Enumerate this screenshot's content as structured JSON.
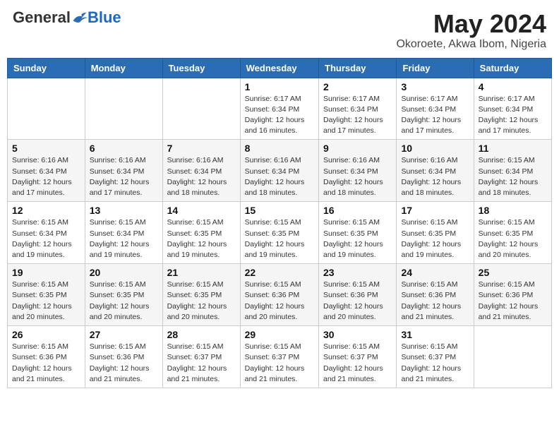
{
  "logo": {
    "general": "General",
    "blue": "Blue"
  },
  "title": {
    "month_year": "May 2024",
    "location": "Okoroete, Akwa Ibom, Nigeria"
  },
  "weekdays": [
    "Sunday",
    "Monday",
    "Tuesday",
    "Wednesday",
    "Thursday",
    "Friday",
    "Saturday"
  ],
  "weeks": [
    [
      {
        "day": "",
        "sunrise": "",
        "sunset": "",
        "daylight": ""
      },
      {
        "day": "",
        "sunrise": "",
        "sunset": "",
        "daylight": ""
      },
      {
        "day": "",
        "sunrise": "",
        "sunset": "",
        "daylight": ""
      },
      {
        "day": "1",
        "sunrise": "Sunrise: 6:17 AM",
        "sunset": "Sunset: 6:34 PM",
        "daylight": "Daylight: 12 hours and 16 minutes."
      },
      {
        "day": "2",
        "sunrise": "Sunrise: 6:17 AM",
        "sunset": "Sunset: 6:34 PM",
        "daylight": "Daylight: 12 hours and 17 minutes."
      },
      {
        "day": "3",
        "sunrise": "Sunrise: 6:17 AM",
        "sunset": "Sunset: 6:34 PM",
        "daylight": "Daylight: 12 hours and 17 minutes."
      },
      {
        "day": "4",
        "sunrise": "Sunrise: 6:17 AM",
        "sunset": "Sunset: 6:34 PM",
        "daylight": "Daylight: 12 hours and 17 minutes."
      }
    ],
    [
      {
        "day": "5",
        "sunrise": "Sunrise: 6:16 AM",
        "sunset": "Sunset: 6:34 PM",
        "daylight": "Daylight: 12 hours and 17 minutes."
      },
      {
        "day": "6",
        "sunrise": "Sunrise: 6:16 AM",
        "sunset": "Sunset: 6:34 PM",
        "daylight": "Daylight: 12 hours and 17 minutes."
      },
      {
        "day": "7",
        "sunrise": "Sunrise: 6:16 AM",
        "sunset": "Sunset: 6:34 PM",
        "daylight": "Daylight: 12 hours and 18 minutes."
      },
      {
        "day": "8",
        "sunrise": "Sunrise: 6:16 AM",
        "sunset": "Sunset: 6:34 PM",
        "daylight": "Daylight: 12 hours and 18 minutes."
      },
      {
        "day": "9",
        "sunrise": "Sunrise: 6:16 AM",
        "sunset": "Sunset: 6:34 PM",
        "daylight": "Daylight: 12 hours and 18 minutes."
      },
      {
        "day": "10",
        "sunrise": "Sunrise: 6:16 AM",
        "sunset": "Sunset: 6:34 PM",
        "daylight": "Daylight: 12 hours and 18 minutes."
      },
      {
        "day": "11",
        "sunrise": "Sunrise: 6:15 AM",
        "sunset": "Sunset: 6:34 PM",
        "daylight": "Daylight: 12 hours and 18 minutes."
      }
    ],
    [
      {
        "day": "12",
        "sunrise": "Sunrise: 6:15 AM",
        "sunset": "Sunset: 6:34 PM",
        "daylight": "Daylight: 12 hours and 19 minutes."
      },
      {
        "day": "13",
        "sunrise": "Sunrise: 6:15 AM",
        "sunset": "Sunset: 6:34 PM",
        "daylight": "Daylight: 12 hours and 19 minutes."
      },
      {
        "day": "14",
        "sunrise": "Sunrise: 6:15 AM",
        "sunset": "Sunset: 6:35 PM",
        "daylight": "Daylight: 12 hours and 19 minutes."
      },
      {
        "day": "15",
        "sunrise": "Sunrise: 6:15 AM",
        "sunset": "Sunset: 6:35 PM",
        "daylight": "Daylight: 12 hours and 19 minutes."
      },
      {
        "day": "16",
        "sunrise": "Sunrise: 6:15 AM",
        "sunset": "Sunset: 6:35 PM",
        "daylight": "Daylight: 12 hours and 19 minutes."
      },
      {
        "day": "17",
        "sunrise": "Sunrise: 6:15 AM",
        "sunset": "Sunset: 6:35 PM",
        "daylight": "Daylight: 12 hours and 19 minutes."
      },
      {
        "day": "18",
        "sunrise": "Sunrise: 6:15 AM",
        "sunset": "Sunset: 6:35 PM",
        "daylight": "Daylight: 12 hours and 20 minutes."
      }
    ],
    [
      {
        "day": "19",
        "sunrise": "Sunrise: 6:15 AM",
        "sunset": "Sunset: 6:35 PM",
        "daylight": "Daylight: 12 hours and 20 minutes."
      },
      {
        "day": "20",
        "sunrise": "Sunrise: 6:15 AM",
        "sunset": "Sunset: 6:35 PM",
        "daylight": "Daylight: 12 hours and 20 minutes."
      },
      {
        "day": "21",
        "sunrise": "Sunrise: 6:15 AM",
        "sunset": "Sunset: 6:35 PM",
        "daylight": "Daylight: 12 hours and 20 minutes."
      },
      {
        "day": "22",
        "sunrise": "Sunrise: 6:15 AM",
        "sunset": "Sunset: 6:36 PM",
        "daylight": "Daylight: 12 hours and 20 minutes."
      },
      {
        "day": "23",
        "sunrise": "Sunrise: 6:15 AM",
        "sunset": "Sunset: 6:36 PM",
        "daylight": "Daylight: 12 hours and 20 minutes."
      },
      {
        "day": "24",
        "sunrise": "Sunrise: 6:15 AM",
        "sunset": "Sunset: 6:36 PM",
        "daylight": "Daylight: 12 hours and 21 minutes."
      },
      {
        "day": "25",
        "sunrise": "Sunrise: 6:15 AM",
        "sunset": "Sunset: 6:36 PM",
        "daylight": "Daylight: 12 hours and 21 minutes."
      }
    ],
    [
      {
        "day": "26",
        "sunrise": "Sunrise: 6:15 AM",
        "sunset": "Sunset: 6:36 PM",
        "daylight": "Daylight: 12 hours and 21 minutes."
      },
      {
        "day": "27",
        "sunrise": "Sunrise: 6:15 AM",
        "sunset": "Sunset: 6:36 PM",
        "daylight": "Daylight: 12 hours and 21 minutes."
      },
      {
        "day": "28",
        "sunrise": "Sunrise: 6:15 AM",
        "sunset": "Sunset: 6:37 PM",
        "daylight": "Daylight: 12 hours and 21 minutes."
      },
      {
        "day": "29",
        "sunrise": "Sunrise: 6:15 AM",
        "sunset": "Sunset: 6:37 PM",
        "daylight": "Daylight: 12 hours and 21 minutes."
      },
      {
        "day": "30",
        "sunrise": "Sunrise: 6:15 AM",
        "sunset": "Sunset: 6:37 PM",
        "daylight": "Daylight: 12 hours and 21 minutes."
      },
      {
        "day": "31",
        "sunrise": "Sunrise: 6:15 AM",
        "sunset": "Sunset: 6:37 PM",
        "daylight": "Daylight: 12 hours and 21 minutes."
      },
      {
        "day": "",
        "sunrise": "",
        "sunset": "",
        "daylight": ""
      }
    ]
  ]
}
